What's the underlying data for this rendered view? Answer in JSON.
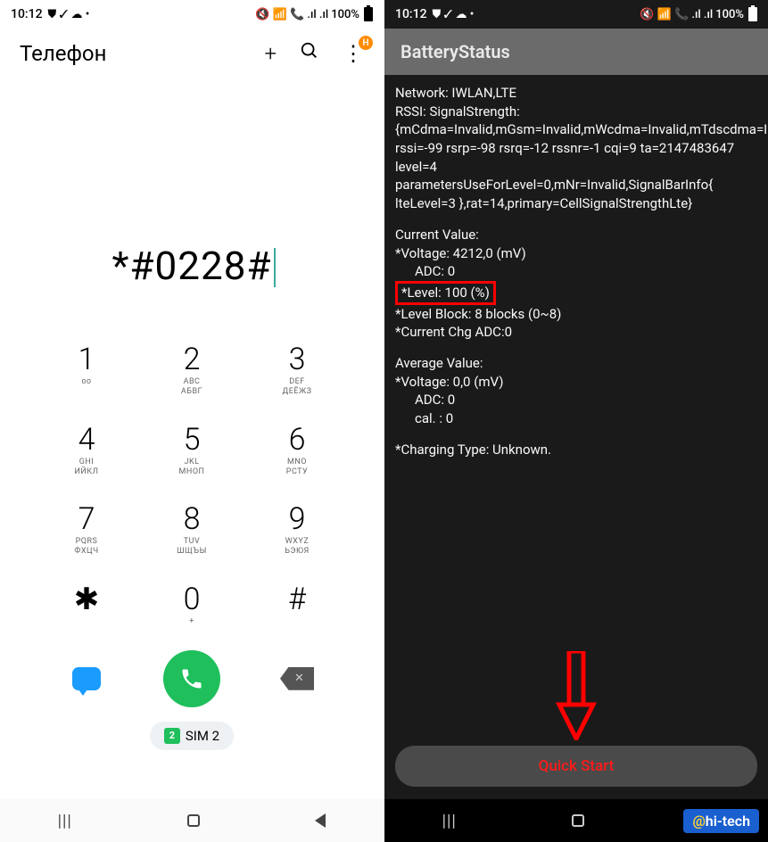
{
  "left": {
    "status": {
      "time": "10:12",
      "icons": "⛊ ✓ ☁ •",
      "right_icons": "🔇 📶 📞 .ıl .ıl",
      "battery": "100%"
    },
    "title": "Телефон",
    "badge": "H",
    "dialed": "*#0228#",
    "keys": [
      {
        "d": "1",
        "sub": "ᴏᴏ"
      },
      {
        "d": "2",
        "sub": "ABC\nАБВГ"
      },
      {
        "d": "3",
        "sub": "DEF\nДЕЁЖЗ"
      },
      {
        "d": "4",
        "sub": "GHI\nИЙКЛ"
      },
      {
        "d": "5",
        "sub": "JKL\nМНОП"
      },
      {
        "d": "6",
        "sub": "MNO\nРСТУ"
      },
      {
        "d": "7",
        "sub": "PQRS\nФХЦЧ"
      },
      {
        "d": "8",
        "sub": "TUV\nШЩЪЫ"
      },
      {
        "d": "9",
        "sub": "WXYZ\nЬЭЮЯ"
      },
      {
        "d": "✱",
        "sub": ""
      },
      {
        "d": "0",
        "sub": "+"
      },
      {
        "d": "#",
        "sub": ""
      }
    ],
    "sim": {
      "num": "2",
      "label": "SIM 2"
    }
  },
  "right": {
    "status": {
      "time": "10:12",
      "icons": "⛊ ✓ ☁ •",
      "battery": "100%"
    },
    "title": "BatteryStatus",
    "text": {
      "network": "Network: IWLAN,LTE",
      "rssi": "RSSI: SignalStrength:{mCdma=Invalid,mGsm=Invalid,mWcdma=Invalid,mTdscdma=Invalid,mLte=CellSignalStrengthLte: rssi=-99 rsrp=-98 rsrq=-12 rssnr=-1 cqi=9 ta=2147483647 level=4 parametersUseForLevel=0,mNr=Invalid,SignalBarInfo{ lteLevel=3 },rat=14,primary=CellSignalStrengthLte}",
      "cv_header": "Current Value:",
      "cv_voltage": "*Voltage:  4212,0 (mV)",
      "cv_adc": "ADC:  0",
      "cv_level": "*Level: 100 (%)",
      "cv_block": "*Level Block: 8 blocks (0~8)",
      "cv_chg": "*Current Chg ADC:0",
      "av_header": "Average Value:",
      "av_voltage": "*Voltage:  0,0 (mV)",
      "av_adc": "ADC:  0",
      "av_cal": "cal. : 0",
      "charging": "*Charging Type: Unknown."
    },
    "button": "Quick Start",
    "watermark": {
      "at": "@",
      "brand": "hi-tech"
    }
  }
}
